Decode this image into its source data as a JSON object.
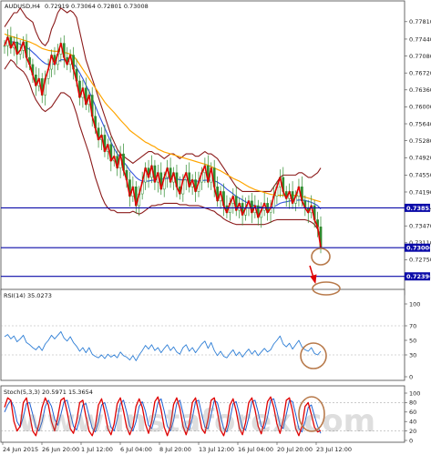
{
  "header": {
    "symbol": "AUDUSD,H4",
    "quote": "0.72919 0.73064 0.72801 0.73008"
  },
  "chart_data": [
    {
      "type": "candlestick",
      "panel": "price",
      "y_ticks": [
        "0.77810",
        "0.77440",
        "0.77080",
        "0.76720",
        "0.76360",
        "0.76000",
        "0.75640",
        "0.75280",
        "0.74920",
        "0.74550",
        "0.74190",
        "0.73830",
        "0.73470",
        "0.73110",
        "0.72750",
        "0.72390"
      ],
      "ylim": [
        0.7212,
        0.78
      ],
      "x_labels": [
        "24 Jun 2015",
        "26 Jun 20:00",
        "1 Jul 12:00",
        "6 Jul 04:00",
        "8 Jul 20:00",
        "13 Jul 12:00",
        "16 Jul 04:00",
        "20 Jul 20:00",
        "23 Jul 12:00"
      ],
      "close": [
        0.773,
        0.7748,
        0.7725,
        0.7738,
        0.7712,
        0.772,
        0.7738,
        0.7705,
        0.769,
        0.7668,
        0.7645,
        0.766,
        0.7625,
        0.766,
        0.768,
        0.771,
        0.769,
        0.7712,
        0.7735,
        0.7705,
        0.769,
        0.771,
        0.768,
        0.7655,
        0.762,
        0.764,
        0.7605,
        0.7625,
        0.758,
        0.7555,
        0.753,
        0.754,
        0.7505,
        0.752,
        0.7485,
        0.7495,
        0.747,
        0.75,
        0.7465,
        0.7445,
        0.741,
        0.743,
        0.739,
        0.7415,
        0.744,
        0.747,
        0.745,
        0.7475,
        0.744,
        0.746,
        0.7425,
        0.745,
        0.747,
        0.744,
        0.746,
        0.743,
        0.7415,
        0.7445,
        0.746,
        0.743,
        0.7445,
        0.742,
        0.744,
        0.746,
        0.7475,
        0.744,
        0.747,
        0.743,
        0.74,
        0.742,
        0.739,
        0.7375,
        0.7395,
        0.741,
        0.738,
        0.7395,
        0.737,
        0.7385,
        0.74,
        0.7375,
        0.739,
        0.7365,
        0.738,
        0.7395,
        0.7375,
        0.7385,
        0.741,
        0.743,
        0.745,
        0.742,
        0.7405,
        0.742,
        0.7395,
        0.741,
        0.743,
        0.74,
        0.7385,
        0.7375,
        0.739,
        0.736,
        0.7345,
        0.7301
      ],
      "bollinger_upper": [
        0.777,
        0.778,
        0.779,
        0.78,
        0.78,
        0.781,
        0.78,
        0.779,
        0.7785,
        0.778,
        0.776,
        0.7745,
        0.7735,
        0.773,
        0.774,
        0.7765,
        0.778,
        0.78,
        0.781,
        0.7805,
        0.78,
        0.7805,
        0.78,
        0.779,
        0.776,
        0.773,
        0.77,
        0.768,
        0.766,
        0.764,
        0.762,
        0.76,
        0.758,
        0.756,
        0.754,
        0.7525,
        0.751,
        0.75,
        0.7495,
        0.749,
        0.7485,
        0.748,
        0.7485,
        0.749,
        0.7495,
        0.75,
        0.7505,
        0.7505,
        0.75,
        0.75,
        0.7495,
        0.749,
        0.7495,
        0.75,
        0.75,
        0.7495,
        0.749,
        0.7495,
        0.75,
        0.75,
        0.75,
        0.7495,
        0.7495,
        0.75,
        0.7505,
        0.75,
        0.75,
        0.7495,
        0.749,
        0.748,
        0.747,
        0.746,
        0.745,
        0.744,
        0.743,
        0.7425,
        0.742,
        0.742,
        0.742,
        0.742,
        0.742,
        0.742,
        0.742,
        0.742,
        0.742,
        0.742,
        0.743,
        0.744,
        0.745,
        0.7455,
        0.7455,
        0.7455,
        0.7455,
        0.7455,
        0.746,
        0.746,
        0.7455,
        0.745,
        0.745,
        0.7455,
        0.746,
        0.747
      ],
      "bollinger_lower": [
        0.768,
        0.769,
        0.77,
        0.7695,
        0.7685,
        0.768,
        0.7675,
        0.7665,
        0.765,
        0.763,
        0.7615,
        0.7605,
        0.7595,
        0.759,
        0.7595,
        0.76,
        0.761,
        0.762,
        0.763,
        0.763,
        0.7625,
        0.762,
        0.7605,
        0.7585,
        0.756,
        0.754,
        0.752,
        0.75,
        0.7475,
        0.745,
        0.743,
        0.741,
        0.7395,
        0.7385,
        0.738,
        0.738,
        0.7375,
        0.7375,
        0.7375,
        0.7375,
        0.7375,
        0.7378,
        0.7375,
        0.7372,
        0.7375,
        0.738,
        0.7385,
        0.739,
        0.739,
        0.7392,
        0.7392,
        0.7395,
        0.7395,
        0.7395,
        0.7395,
        0.7395,
        0.7392,
        0.7392,
        0.7392,
        0.739,
        0.739,
        0.739,
        0.739,
        0.7388,
        0.7385,
        0.7383,
        0.738,
        0.7378,
        0.7372,
        0.7368,
        0.7362,
        0.7358,
        0.7355,
        0.7352,
        0.735,
        0.735,
        0.735,
        0.735,
        0.735,
        0.735,
        0.735,
        0.735,
        0.735,
        0.735,
        0.7352,
        0.7355,
        0.7358,
        0.736,
        0.736,
        0.736,
        0.736,
        0.736,
        0.736,
        0.736,
        0.736,
        0.736,
        0.736,
        0.7358,
        0.7355,
        0.735,
        0.734,
        0.7325
      ],
      "ma_orange": [
        0.7755,
        0.7752,
        0.775,
        0.7748,
        0.7746,
        0.7744,
        0.7742,
        0.774,
        0.7738,
        0.7735,
        0.7732,
        0.7728,
        0.7724,
        0.7722,
        0.772,
        0.7719,
        0.7718,
        0.7718,
        0.7718,
        0.7716,
        0.7714,
        0.7712,
        0.7708,
        0.77,
        0.769,
        0.768,
        0.767,
        0.766,
        0.765,
        0.764,
        0.763,
        0.762,
        0.761,
        0.7602,
        0.7595,
        0.7588,
        0.758,
        0.7572,
        0.7565,
        0.7558,
        0.755,
        0.7545,
        0.754,
        0.7535,
        0.753,
        0.7525,
        0.7522,
        0.7518,
        0.7515,
        0.751,
        0.7507,
        0.7504,
        0.7502,
        0.75,
        0.7498,
        0.7496,
        0.7494,
        0.7492,
        0.749,
        0.7488,
        0.7486,
        0.7484,
        0.7482,
        0.748,
        0.7478,
        0.7476,
        0.7473,
        0.747,
        0.7467,
        0.7464,
        0.746,
        0.7456,
        0.7452,
        0.7448,
        0.7445,
        0.7442,
        0.7438,
        0.7434,
        0.743,
        0.7427,
        0.7424,
        0.7422,
        0.742,
        0.7418,
        0.7416,
        0.7414,
        0.7413,
        0.7412,
        0.7412,
        0.7412,
        0.7413,
        0.7413,
        0.7412,
        0.7412,
        0.7411,
        0.741,
        0.7408,
        0.7406,
        0.7404,
        0.7402,
        0.74,
        0.7398
      ],
      "ma_blue": [
        0.7735,
        0.7738,
        0.7738,
        0.7738,
        0.7736,
        0.7733,
        0.773,
        0.7726,
        0.7722,
        0.7716,
        0.771,
        0.7703,
        0.7697,
        0.7692,
        0.769,
        0.769,
        0.7692,
        0.7695,
        0.77,
        0.77,
        0.7698,
        0.7696,
        0.7692,
        0.7684,
        0.7672,
        0.766,
        0.7646,
        0.7633,
        0.7618,
        0.7602,
        0.7585,
        0.757,
        0.7555,
        0.754,
        0.7525,
        0.7512,
        0.75,
        0.7492,
        0.7483,
        0.7475,
        0.7465,
        0.7458,
        0.745,
        0.7445,
        0.7442,
        0.7442,
        0.7442,
        0.7444,
        0.7444,
        0.7446,
        0.7446,
        0.7447,
        0.7448,
        0.7448,
        0.7448,
        0.7447,
        0.7445,
        0.7445,
        0.7445,
        0.7444,
        0.7443,
        0.7442,
        0.7442,
        0.7443,
        0.7444,
        0.7444,
        0.7444,
        0.7443,
        0.744,
        0.7436,
        0.7431,
        0.7425,
        0.742,
        0.7415,
        0.741,
        0.7406,
        0.7402,
        0.7398,
        0.7395,
        0.7392,
        0.739,
        0.7388,
        0.7387,
        0.7387,
        0.7386,
        0.7386,
        0.7388,
        0.7391,
        0.7395,
        0.7397,
        0.7398,
        0.74,
        0.74,
        0.7401,
        0.7402,
        0.7402,
        0.7401,
        0.7399,
        0.7397,
        0.7394,
        0.739,
        0.7383
      ],
      "price_lines": [
        {
          "value": 0.73853,
          "label": "0.73853",
          "color": "#0a0aa8"
        },
        {
          "value": 0.73006,
          "label": "0.73006",
          "color": "#0a0aa8"
        },
        {
          "value": 0.72396,
          "label": "0.72396",
          "color": "#0a0aa8"
        }
      ]
    },
    {
      "type": "line",
      "panel": "rsi",
      "title": "RSI(14) 35.0273",
      "y_ticks": [
        "100",
        "70",
        "50",
        "30",
        "0"
      ],
      "ylim": [
        0,
        100
      ],
      "values": [
        55,
        58,
        52,
        56,
        48,
        52,
        57,
        47,
        44,
        40,
        37,
        42,
        36,
        45,
        50,
        57,
        52,
        57,
        62,
        53,
        49,
        55,
        47,
        42,
        35,
        40,
        33,
        40,
        31,
        28,
        26,
        30,
        25,
        31,
        27,
        30,
        26,
        34,
        29,
        27,
        23,
        29,
        22,
        30,
        36,
        43,
        38,
        44,
        36,
        40,
        33,
        39,
        44,
        36,
        41,
        34,
        31,
        40,
        44,
        35,
        40,
        33,
        39,
        45,
        49,
        39,
        47,
        36,
        29,
        35,
        28,
        26,
        32,
        37,
        29,
        34,
        27,
        33,
        38,
        31,
        36,
        29,
        34,
        39,
        34,
        37,
        45,
        50,
        56,
        45,
        41,
        46,
        38,
        44,
        50,
        41,
        37,
        35,
        40,
        32,
        30,
        35
      ]
    },
    {
      "type": "line",
      "panel": "stochastic",
      "title": "Stoch(5,3,3) 20.5971 15.3654",
      "y_ticks": [
        "100",
        "80",
        "60",
        "40",
        "20",
        "0"
      ],
      "ylim": [
        0,
        100
      ],
      "series": [
        {
          "name": "",
          "values": [
            70,
            90,
            85,
            40,
            20,
            30,
            80,
            90,
            55,
            20,
            10,
            35,
            70,
            90,
            75,
            40,
            20,
            50,
            85,
            90,
            60,
            25,
            15,
            40,
            80,
            85,
            50,
            20,
            10,
            30,
            75,
            88,
            60,
            25,
            12,
            35,
            78,
            90,
            62,
            28,
            12,
            30,
            72,
            88,
            70,
            35,
            15,
            40,
            82,
            92,
            65,
            28,
            10,
            30,
            76,
            90,
            68,
            30,
            12,
            35,
            80,
            90,
            60,
            25,
            15,
            45,
            85,
            90,
            60,
            22,
            10,
            32,
            75,
            88,
            62,
            26,
            12,
            38,
            80,
            90,
            65,
            30,
            14,
            40,
            82,
            92,
            70,
            35,
            15,
            42,
            85,
            90,
            62,
            25,
            10,
            30,
            72,
            80,
            55,
            28,
            18,
            21
          ]
        },
        {
          "name": "",
          "values": [
            60,
            75,
            85,
            70,
            40,
            28,
            50,
            78,
            80,
            55,
            28,
            20,
            40,
            72,
            85,
            72,
            45,
            32,
            55,
            82,
            85,
            58,
            30,
            22,
            45,
            75,
            78,
            52,
            26,
            18,
            40,
            75,
            80,
            55,
            28,
            20,
            45,
            78,
            85,
            60,
            30,
            20,
            40,
            72,
            82,
            62,
            32,
            25,
            48,
            80,
            88,
            62,
            30,
            20,
            42,
            78,
            85,
            58,
            28,
            22,
            48,
            82,
            85,
            55,
            28,
            25,
            55,
            85,
            80,
            52,
            25,
            18,
            45,
            78,
            82,
            55,
            26,
            22,
            48,
            82,
            85,
            60,
            30,
            25,
            50,
            85,
            88,
            62,
            32,
            25,
            55,
            85,
            82,
            55,
            25,
            18,
            40,
            70,
            75,
            52,
            30,
            15
          ]
        }
      ]
    }
  ],
  "watermark": "www.instaforex.com",
  "colors": {
    "price_line": "#e00000",
    "bollinger": "#8b1a1a",
    "ma_orange": "#ffa500",
    "ma_blue": "#3355dd",
    "horizontal_level": "#0a0aa8",
    "rsi_line": "#2f7fd6",
    "stoch_main": "#e00000",
    "stoch_signal": "#1f5fd0",
    "annotation_circle": "#b87a4b",
    "arrow": "#e00000"
  },
  "annotations": [
    "circle",
    "circle",
    "circle",
    "circle",
    "down-arrow"
  ]
}
